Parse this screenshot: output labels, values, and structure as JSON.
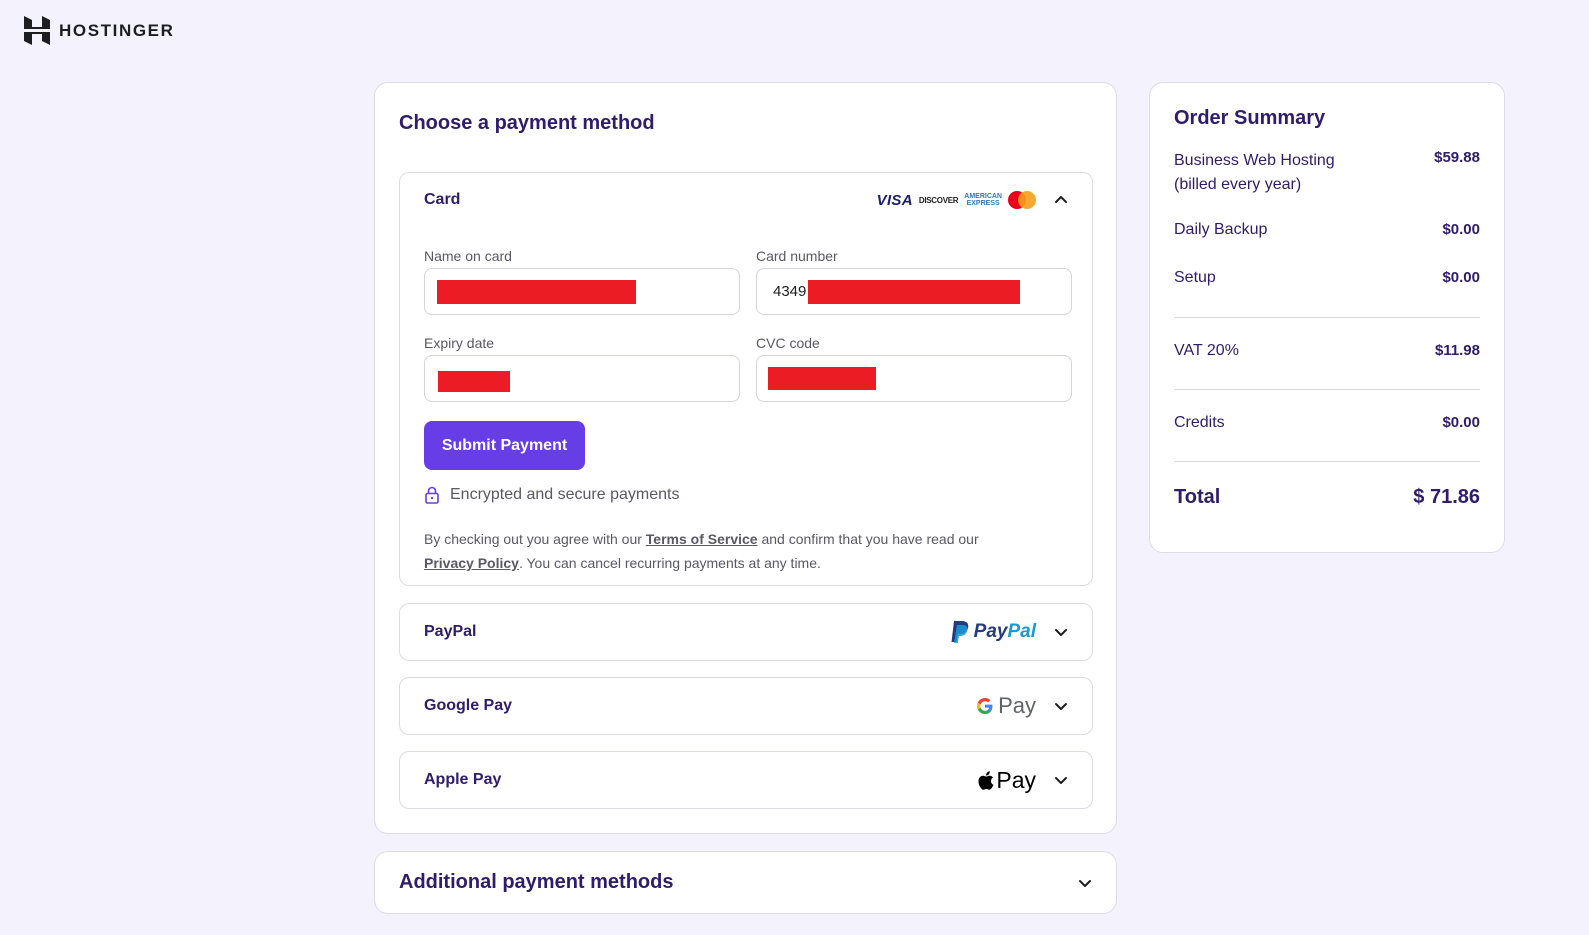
{
  "brand": {
    "name": "HOSTINGER"
  },
  "payment": {
    "title": "Choose a payment method",
    "card": {
      "label": "Card",
      "brands": [
        "VISA",
        "DISCOVER",
        "AMERICAN EXPRESS",
        "mastercard"
      ],
      "name_label": "Name on card",
      "number_label": "Card number",
      "number_prefix": "4349",
      "expiry_label": "Expiry date",
      "cvc_label": "CVC code",
      "submit_label": "Submit Payment",
      "secure_text": "Encrypted and secure payments",
      "legal": {
        "part1": "By checking out you agree with our ",
        "terms": "Terms of Service",
        "part2": " and confirm that you have read our ",
        "privacy": "Privacy Policy",
        "part3": ". You can cancel recurring payments at any time."
      }
    },
    "paypal": {
      "label": "PayPal",
      "logo_a": "Pay",
      "logo_b": "Pal"
    },
    "googlepay": {
      "label": "Google Pay",
      "logo": "Pay"
    },
    "applepay": {
      "label": "Apple Pay",
      "logo": "Pay"
    }
  },
  "additional": {
    "title": "Additional payment methods"
  },
  "summary": {
    "title": "Order Summary",
    "items": [
      {
        "name": "Business Web Hosting",
        "sub": "(billed every year)",
        "value": "$59.88"
      },
      {
        "name": "Daily Backup",
        "value": "$0.00"
      },
      {
        "name": "Setup",
        "value": "$0.00"
      },
      {
        "name": "VAT 20%",
        "value": "$11.98"
      },
      {
        "name": "Credits",
        "value": "$0.00"
      }
    ],
    "total_label": "Total",
    "total_value": "$ 71.86"
  },
  "colors": {
    "accent": "#673de6",
    "text": "#2f1c6a",
    "background": "#f4f3fd",
    "redaction": "#ec1c24"
  }
}
